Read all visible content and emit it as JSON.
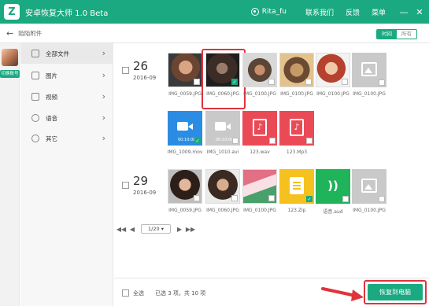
{
  "app": {
    "logo_letter": "Z",
    "title": "安卓恢复大师 1.0 Beta"
  },
  "titlebar": {
    "user": "Rita_fu",
    "links": [
      "联系我们",
      "反馈",
      "菜单"
    ],
    "controls": {
      "minimize": "—",
      "close": "✕"
    }
  },
  "subheader": {
    "back": "←",
    "title": "陌陌附件",
    "toggle": [
      "时间",
      "所有"
    ],
    "toggle_active": "时间"
  },
  "account": {
    "switch_label": "切换账号"
  },
  "sidebar": {
    "items": [
      {
        "label": "全部文件",
        "icon": "file-icon",
        "active": true
      },
      {
        "label": "图片",
        "icon": "image-icon",
        "active": false
      },
      {
        "label": "视频",
        "icon": "video-icon",
        "active": false
      },
      {
        "label": "语音",
        "icon": "voice-icon",
        "active": false
      },
      {
        "label": "其它",
        "icon": "more-icon",
        "active": false
      }
    ],
    "arrow": "›"
  },
  "groups": [
    {
      "day": "26",
      "month": "2016-09",
      "files": [
        {
          "name": "IMG_0059.JPG",
          "type": "photo",
          "fill": "p1",
          "checked": false
        },
        {
          "name": "IMG_0060.JPG",
          "type": "photo",
          "fill": "p2",
          "checked": true
        },
        {
          "name": "IMG_0100.JPG",
          "type": "photo",
          "fill": "p3",
          "checked": false
        },
        {
          "name": "IMG_0100.JPG",
          "type": "photo",
          "fill": "p4",
          "checked": false
        },
        {
          "name": "IMG_0100.JPG",
          "type": "photo",
          "fill": "p5",
          "checked": false
        },
        {
          "name": "IMG_0100.JPG",
          "type": "photo-placeholder",
          "fill": "grey",
          "checked": false
        },
        {
          "name": "IMG_1009.mov",
          "type": "video",
          "fill": "blue",
          "duration": "00:10:00",
          "checked": true
        },
        {
          "name": "IMG_1010.avi",
          "type": "video",
          "fill": "grey",
          "duration": "00:10:00",
          "checked": false
        },
        {
          "name": "123.wav",
          "type": "audio",
          "fill": "red",
          "checked": false
        },
        {
          "name": "123.Mp3",
          "type": "audio",
          "fill": "red",
          "checked": false
        }
      ]
    },
    {
      "day": "29",
      "month": "2016-09",
      "files": [
        {
          "name": "IMG_0059.JPG",
          "type": "photo",
          "fill": "p6",
          "checked": false
        },
        {
          "name": "IMG_0060.JPG",
          "type": "photo",
          "fill": "p7",
          "checked": false
        },
        {
          "name": "IMG_0100.JPG",
          "type": "photo",
          "fill": "p8",
          "checked": false
        },
        {
          "name": "123.Zip",
          "type": "zip",
          "fill": "yellow",
          "checked": true
        },
        {
          "name": "语音.aud",
          "type": "voice",
          "fill": "green",
          "checked": false
        },
        {
          "name": "IMG_0100.JPG",
          "type": "photo-placeholder",
          "fill": "grey",
          "checked": false
        }
      ]
    }
  ],
  "pager": {
    "first": "◀◀",
    "prev": "◀",
    "page": "1/20 ▾",
    "next": "▶",
    "last": "▶▶"
  },
  "footer": {
    "select_all": "全选",
    "count": "已选 3 项，共 10 项",
    "restore": "恢复到电脑"
  },
  "colors": {
    "brand": "#1aa980",
    "highlight": "#e0333d"
  }
}
